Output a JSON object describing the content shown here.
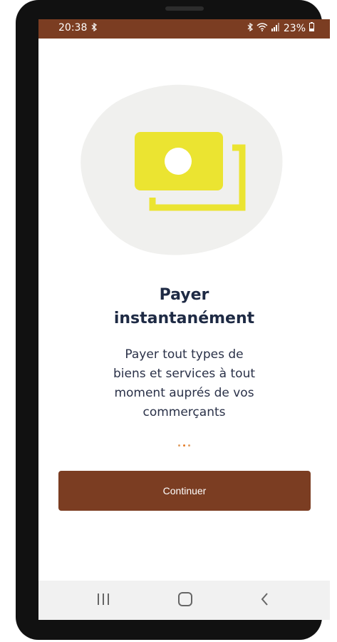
{
  "status_bar": {
    "time": "20:38",
    "battery": "23%",
    "icons": [
      "bluetooth-icon",
      "wifi-icon",
      "signal-icon",
      "battery-icon"
    ]
  },
  "onboarding": {
    "title_line1": "Payer",
    "title_line2": "instantanément",
    "description": [
      "Payer tout types de",
      "biens et services à tout",
      "moment auprés de vos",
      "commerçants"
    ],
    "page_indicator": {
      "total": 3,
      "active": 1
    },
    "continue_label": "Continuer"
  },
  "nav_bar": {
    "buttons": [
      "recent-apps-icon",
      "home-icon",
      "back-icon"
    ]
  },
  "colors": {
    "brand": "#7b3d22",
    "accent_yellow": "#ebe431",
    "blob": "#f0f0ee",
    "title_text": "#1e2a44",
    "dot_active": "#e57a25"
  }
}
